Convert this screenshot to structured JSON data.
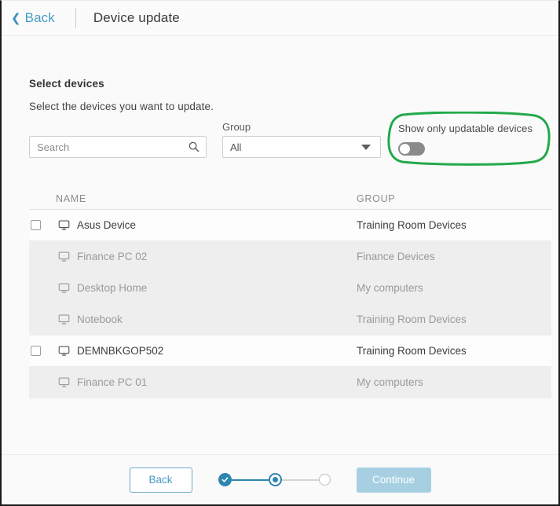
{
  "header": {
    "back_label": "Back",
    "back_icon": "chevron-left-icon",
    "title": "Device update"
  },
  "main": {
    "section_title": "Select devices",
    "section_subtitle": "Select the devices you want to update."
  },
  "filters": {
    "search": {
      "placeholder": "Search",
      "value": "",
      "icon": "search-icon"
    },
    "group": {
      "label": "Group",
      "selected": "All",
      "options": [
        "All"
      ],
      "icon": "chevron-down-icon"
    },
    "updatable_toggle": {
      "label": "Show only updatable devices",
      "state": "off"
    }
  },
  "annotation": {
    "shape": "ellipse-highlight",
    "color": "#23a94a",
    "target": "Show only updatable devices"
  },
  "table": {
    "columns": [
      "NAME",
      "GROUP"
    ],
    "rows": [
      {
        "name": "Asus Device",
        "group": "Training Room Devices",
        "selectable": true,
        "checked": false
      },
      {
        "name": "Finance PC 02",
        "group": "Finance Devices",
        "selectable": false,
        "checked": false
      },
      {
        "name": "Desktop Home",
        "group": "My computers",
        "selectable": false,
        "checked": false
      },
      {
        "name": "Notebook",
        "group": "Training Room Devices",
        "selectable": false,
        "checked": false
      },
      {
        "name": "DEMNBKGOP502",
        "group": "Training Room Devices",
        "selectable": true,
        "checked": false
      },
      {
        "name": "Finance PC 01",
        "group": "My computers",
        "selectable": false,
        "checked": false
      }
    ]
  },
  "footer": {
    "back_label": "Back",
    "continue_label": "Continue",
    "continue_enabled": false,
    "steps": {
      "total": 3,
      "current": 2,
      "completed": 1
    }
  },
  "colors": {
    "accent": "#2e86b0",
    "link": "#4a9bc4",
    "annotation_green": "#23a94a",
    "disabled_row": "#eeeeee"
  }
}
